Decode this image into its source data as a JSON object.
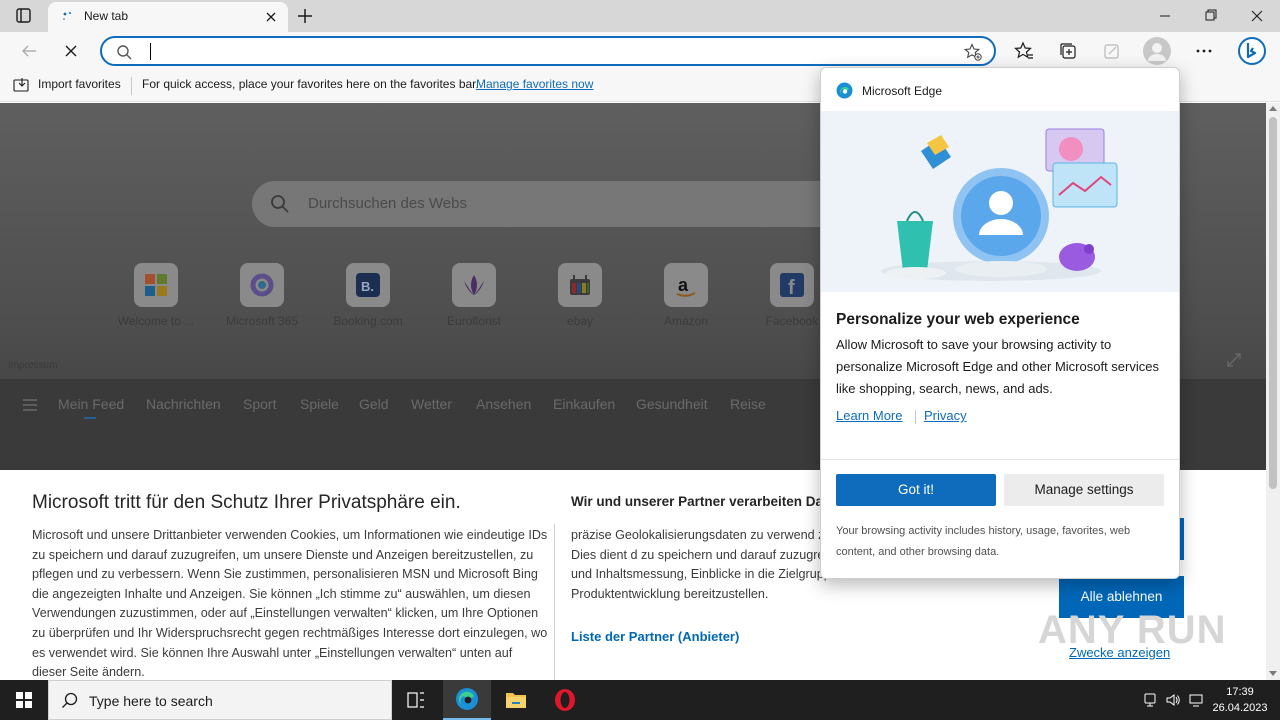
{
  "browser": {
    "tab": {
      "title": "New tab"
    },
    "favorites_bar": {
      "import_label": "Import favorites",
      "hint": "For quick access, place your favorites here on the favorites bar.",
      "manage_link": "Manage favorites now"
    },
    "address_bar": {
      "value": ""
    }
  },
  "new_tab_page": {
    "search_placeholder": "Durchsuchen des Webs",
    "tiles": [
      {
        "label": "Welcome to ...",
        "icon": "microsoft-logo-icon"
      },
      {
        "label": "Microsoft 365",
        "icon": "microsoft365-logo-icon"
      },
      {
        "label": "Booking.com",
        "icon": "booking-logo-icon"
      },
      {
        "label": "Euroflorist",
        "icon": "euroflorist-logo-icon"
      },
      {
        "label": "ebay",
        "icon": "ebay-logo-icon"
      },
      {
        "label": "Amazon",
        "icon": "amazon-logo-icon"
      },
      {
        "label": "Facebook",
        "icon": "facebook-logo-icon"
      }
    ],
    "impressum": "Impressum",
    "feed_nav": [
      "Mein Feed",
      "Nachrichten",
      "Sport",
      "Spiele",
      "Geld",
      "Wetter",
      "Ansehen",
      "Einkaufen",
      "Gesundheit",
      "Reise"
    ]
  },
  "cookie_banner": {
    "title": "Microsoft tritt für den Schutz Ihrer Privatsphäre ein.",
    "body": "Microsoft und unsere Drittanbieter verwenden Cookies, um Informationen wie eindeutige IDs zu speichern und darauf zuzugreifen, um unsere Dienste und Anzeigen bereitzustellen, zu pflegen und zu verbessern. Wenn Sie zustimmen, personalisieren MSN und Microsoft Bing die angezeigten Inhalte und Anzeigen. Sie können „Ich stimme zu“ auswählen, um diesen Verwendungen zuzustimmen, oder auf „Einstellungen verwalten“ klicken, um Ihre Optionen zu überprüfen und Ihr Widerspruchsrecht gegen rechtmäßiges Interesse dort einzulegen, wo es verwendet wird.  Sie können Ihre Auswahl unter „Einstellungen verwalten“ unten auf dieser Seite ändern.",
    "title2": "Wir und unserer Partner verarbeiten Dat",
    "body2": "präzise Geolokalisierungsdaten zu verwend zur Identifizierung zu scannen. Dies dient d zu speichern und darauf zuzugreifen sowie Inhalte, Anzeigen- und Inhaltsmessung, Einblicke in die Zielgruppe und Informationen zur Produktentwicklung bereitzustellen.",
    "partner_link": "Liste der Partner (Anbieter)",
    "reject_button": "Alle ablehnen",
    "purposes_link": "Zwecke anzeigen",
    "watermark": "ANY RUN"
  },
  "edge_popup": {
    "brand": "Microsoft Edge",
    "title": "Personalize your web experience",
    "body": "Allow Microsoft to save your browsing activity to personalize Microsoft Edge and other Microsoft services like shopping, search, news, and ads.",
    "learn_more": "Learn More",
    "privacy": "Privacy",
    "got_it": "Got it!",
    "manage_settings": "Manage settings",
    "footnote": "Your browsing activity includes history, usage, favorites, web content, and other browsing data."
  },
  "taskbar": {
    "search_placeholder": "Type here to search",
    "time": "17:39",
    "date": "26.04.2023"
  },
  "colors": {
    "accent": "#0f6cbd",
    "cookie_blue": "#0067b8",
    "taskbar": "#1f1f1f"
  }
}
